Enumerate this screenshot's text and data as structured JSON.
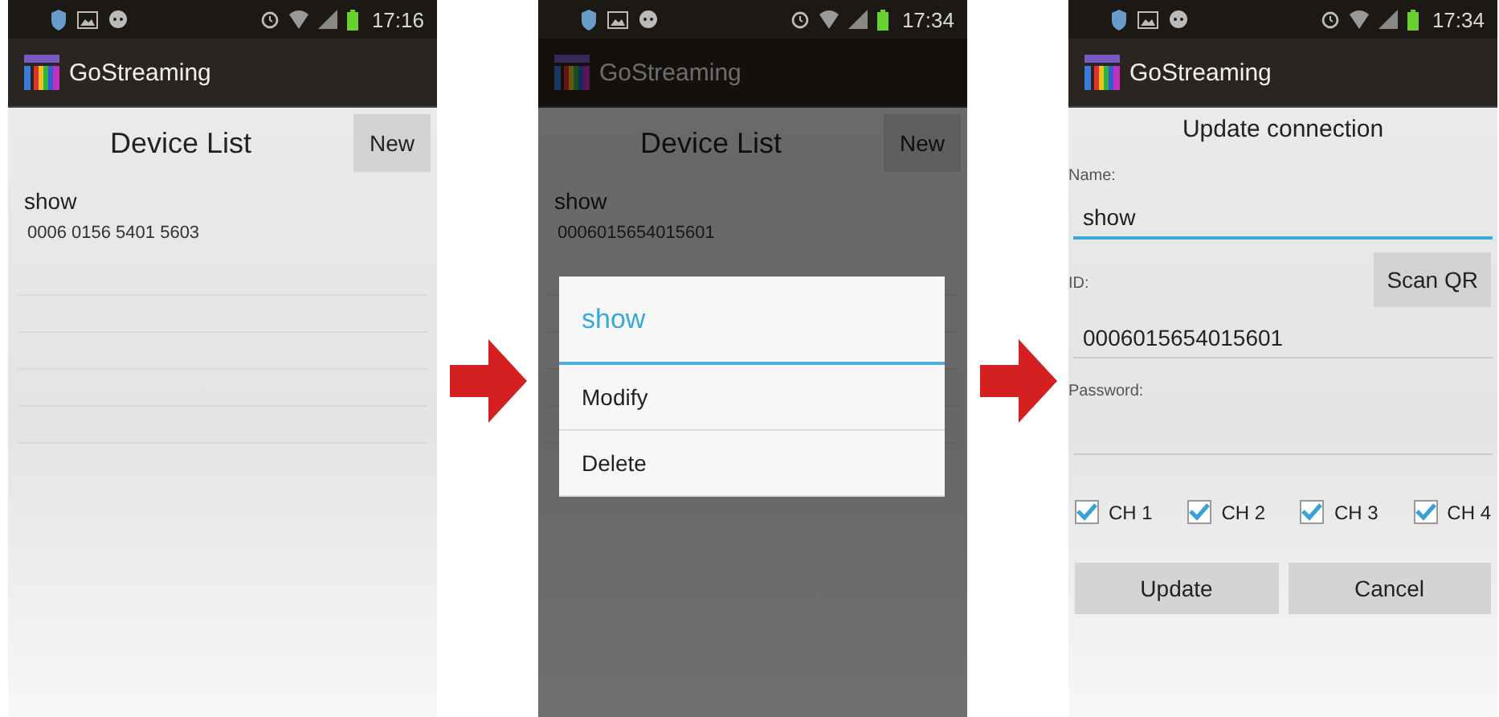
{
  "screens": [
    {
      "kind": "list",
      "dimmed": false,
      "status": {
        "time": "17:16"
      },
      "app_title": "GoStreaming",
      "title": "Device List",
      "new_button": "New",
      "devices": [
        {
          "name": "show",
          "id": "0006 0156 5401 5603"
        }
      ]
    },
    {
      "kind": "list",
      "dimmed": true,
      "status": {
        "time": "17:34"
      },
      "app_title": "GoStreaming",
      "title": "Device List",
      "new_button": "New",
      "devices": [
        {
          "name": "show",
          "id": "0006015654015601"
        }
      ],
      "menu": {
        "title": "show",
        "items": [
          "Modify",
          "Delete"
        ]
      }
    },
    {
      "kind": "form",
      "dimmed": false,
      "status": {
        "time": "17:34"
      },
      "app_title": "GoStreaming",
      "title": "Update connection",
      "fields": [
        {
          "label": "Name:",
          "value": "show",
          "focused": true
        },
        {
          "label": "ID:",
          "value": "0006015654015601",
          "focused": false,
          "action": "Scan QR"
        },
        {
          "label": "Password:",
          "focused": false
        }
      ],
      "channels": [
        {
          "label": "CH 1",
          "checked": true
        },
        {
          "label": "CH 2",
          "checked": true
        },
        {
          "label": "CH 3",
          "checked": true
        },
        {
          "label": "CH 4",
          "checked": true
        }
      ],
      "buttons": [
        "Update",
        "Cancel"
      ]
    }
  ]
}
